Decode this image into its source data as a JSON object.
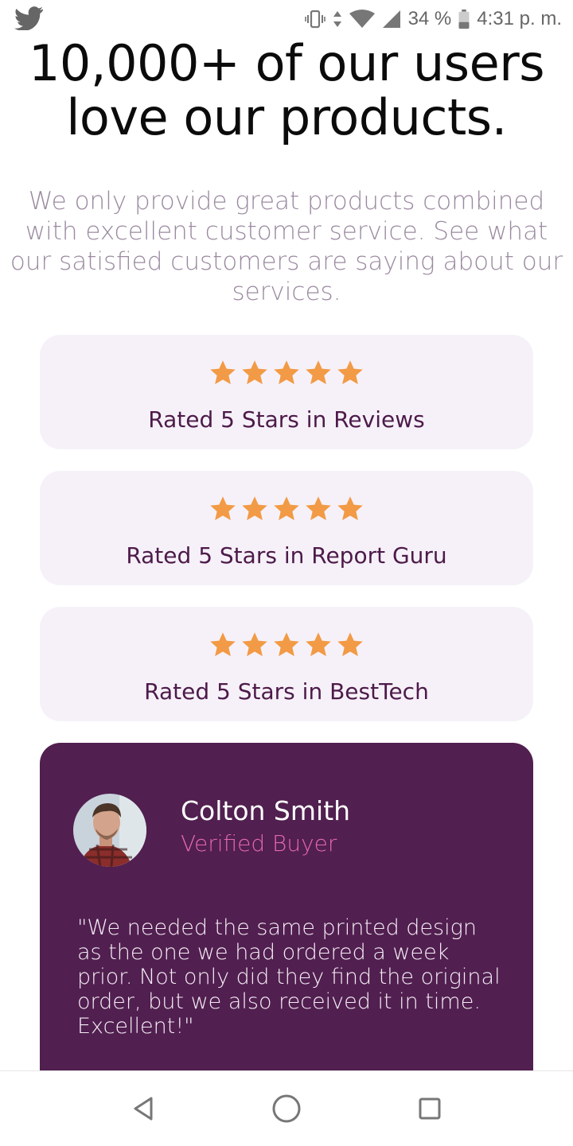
{
  "status_bar": {
    "battery": "34 %",
    "time": "4:31 p. m.",
    "icons": [
      "twitter-icon",
      "vibrate-icon",
      "data-arrows-icon",
      "wifi-icon",
      "signal-icon",
      "battery-icon"
    ]
  },
  "hero": {
    "title_line1": "10,000+ of our users",
    "title_line2": "love our products.",
    "subtitle": "We only provide great products combined with excellent customer service. See what our satisfied customers are saying about our services."
  },
  "ratings": [
    {
      "label": "Rated 5 Stars in Reviews",
      "stars": 5
    },
    {
      "label": "Rated 5 Stars in Report Guru",
      "stars": 5
    },
    {
      "label": "Rated 5 Stars in BestTech",
      "stars": 5
    }
  ],
  "testimonial": {
    "name": "Colton Smith",
    "role": "Verified Buyer",
    "quote": "\"We needed the same printed design as the one we had ordered a week prior. Not only did they find the original order, but we also received it in time. Excellent!\""
  },
  "nav_bar": {
    "buttons": [
      "back-button",
      "home-button",
      "recent-apps-button"
    ]
  },
  "colors": {
    "star": "#f29a45",
    "card_bg": "#f6f1f8",
    "label": "#4d1a4a",
    "testimonial_bg": "#511f50",
    "role": "#e267b1",
    "subtitle": "#9b8aa0"
  }
}
